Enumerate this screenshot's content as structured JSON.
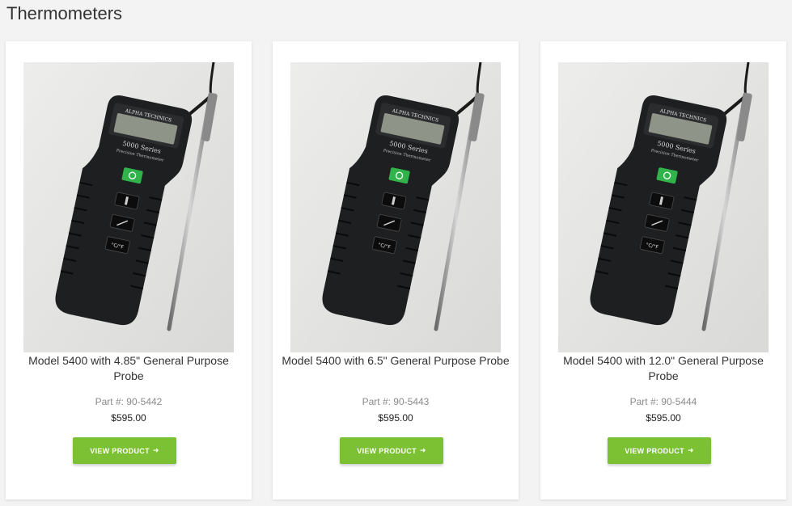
{
  "page": {
    "title": "Thermometers"
  },
  "products": [
    {
      "name": "Model 5400 with 4.85\" General Purpose Probe",
      "part": "Part #: 90-5442",
      "price": "$595.00",
      "button": "VIEW PRODUCT",
      "image_brand": "ALPHA TECHNICS",
      "image_series": "5000 Series",
      "image_subtitle": "Precision Thermometer",
      "image_key": "°C/°F"
    },
    {
      "name": "Model 5400 with 6.5\" General Purpose Probe",
      "part": "Part #: 90-5443",
      "price": "$595.00",
      "button": "VIEW PRODUCT",
      "image_brand": "ALPHA TECHNICS",
      "image_series": "5000 Series",
      "image_subtitle": "Precision Thermometer",
      "image_key": "°C/°F"
    },
    {
      "name": "Model 5400 with 12.0\" General Purpose Probe",
      "part": "Part #: 90-5444",
      "price": "$595.00",
      "button": "VIEW PRODUCT",
      "image_brand": "ALPHA TECHNICS",
      "image_series": "5000 Series",
      "image_subtitle": "Precision Thermometer",
      "image_key": "°C/°F"
    }
  ],
  "icons": {
    "button_arrow": "arrow-right-icon"
  },
  "colors": {
    "button": "#7cc033",
    "power_key": "#2fb34a",
    "device_body": "#1e1f21"
  }
}
